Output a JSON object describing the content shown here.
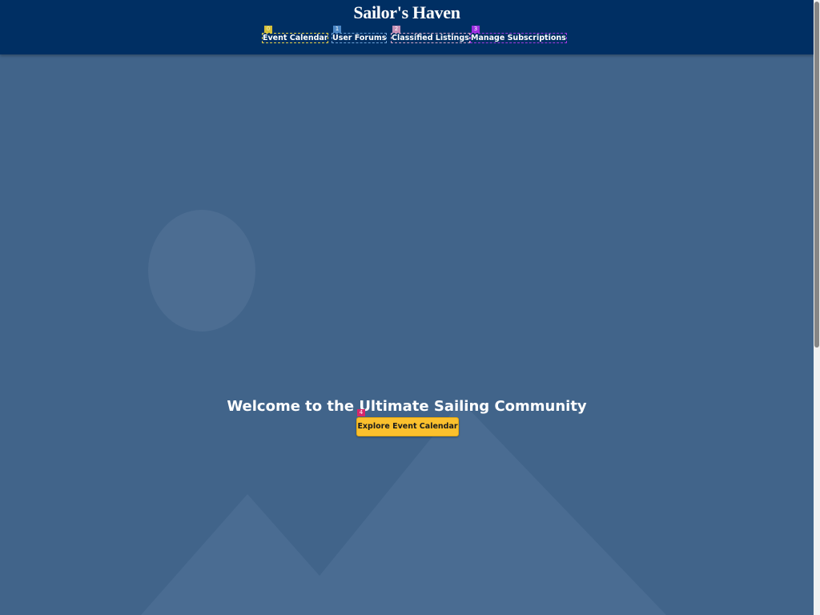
{
  "site": {
    "title": "Sailor's Haven"
  },
  "nav": {
    "items": [
      {
        "label": "Event Calendar",
        "marker": "0"
      },
      {
        "label": "User Forums",
        "marker": "1"
      },
      {
        "label": "Classified Listings",
        "marker": "2"
      },
      {
        "label": "Manage Subscriptions",
        "marker": "3"
      }
    ]
  },
  "hero": {
    "heading": "Welcome to the Ultimate Sailing Community",
    "cta_label": "Explore Event Calendar",
    "cta_marker": "4"
  },
  "colors": {
    "header_bg": "#002f63",
    "page_bg": "#41648a",
    "cta_bg": "#fbc02d"
  }
}
